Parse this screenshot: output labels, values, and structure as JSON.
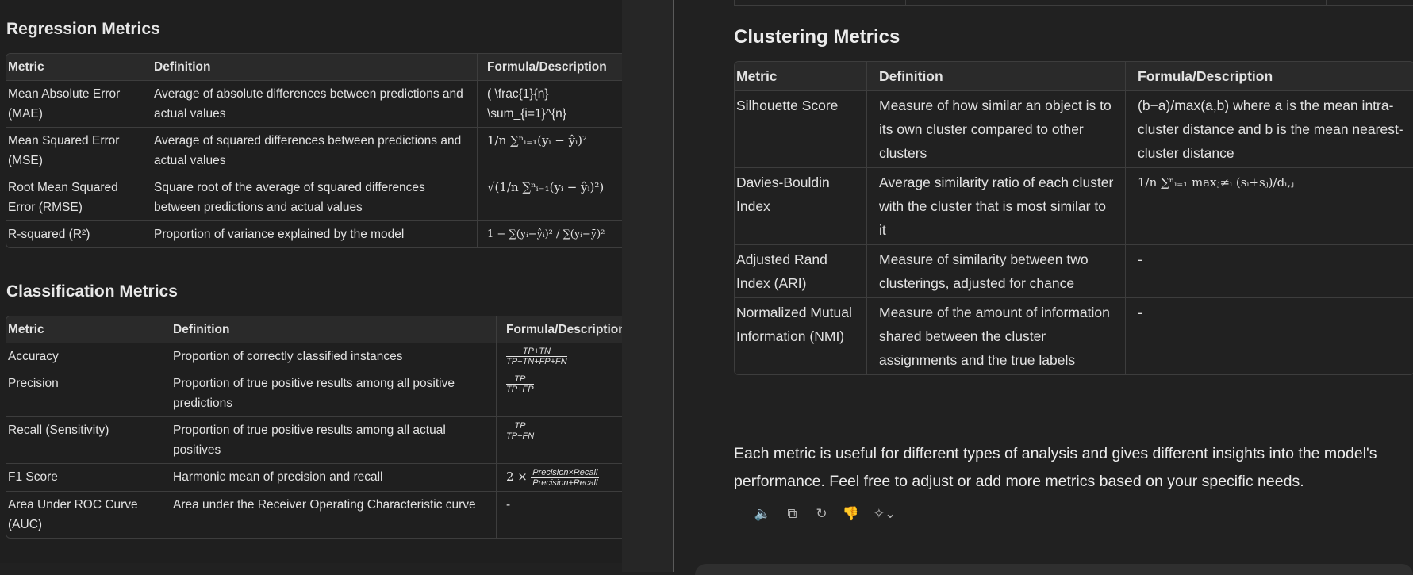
{
  "left": {
    "regression": {
      "heading": "Regression Metrics",
      "headers": [
        "Metric",
        "Definition",
        "Formula/Description"
      ],
      "rows": [
        {
          "metric": "Mean Absolute Error (MAE)",
          "definition": "Average of absolute differences between predictions and actual values",
          "formula": "( \\frac{1}{n} \\sum_{i=1}^{n}"
        },
        {
          "metric": "Mean Squared Error (MSE)",
          "definition": "Average of squared differences between predictions and actual values",
          "formula": "1/n ∑ⁿᵢ₌₁(yᵢ − ŷᵢ)²"
        },
        {
          "metric": "Root Mean Squared Error (RMSE)",
          "definition": "Square root of the average of squared differences between predictions and actual values",
          "formula": "√(1/n ∑ⁿᵢ₌₁(yᵢ − ŷᵢ)²)"
        },
        {
          "metric": "R-squared (R²)",
          "definition": "Proportion of variance explained by the model",
          "formula": "1 − ∑(yᵢ−ŷᵢ)² / ∑(yᵢ−ȳ)²"
        }
      ]
    },
    "classification": {
      "heading": "Classification Metrics",
      "headers": [
        "Metric",
        "Definition",
        "Formula/Description"
      ],
      "rows": [
        {
          "metric": "Accuracy",
          "definition": "Proportion of correctly classified instances",
          "num": "TP+TN",
          "den": "TP+TN+FP+FN"
        },
        {
          "metric": "Precision",
          "definition": "Proportion of true positive results among all positive predictions",
          "num": "TP",
          "den": "TP+FP"
        },
        {
          "metric": "Recall (Sensitivity)",
          "definition": "Proportion of true positive results among all actual positives",
          "num": "TP",
          "den": "TP+FN"
        },
        {
          "metric": "F1 Score",
          "definition": "Harmonic mean of precision and recall",
          "prefix": "2 ×",
          "num": "Precision×Recall",
          "den": "Precision+Recall"
        },
        {
          "metric": "Area Under ROC Curve (AUC)",
          "definition": "Area under the Receiver Operating Characteristic curve",
          "text": "-"
        }
      ]
    }
  },
  "right": {
    "heading": "Clustering Metrics",
    "headers": [
      "Metric",
      "Definition",
      "Formula/Description"
    ],
    "rows": [
      {
        "metric": "Silhouette Score",
        "definition": "Measure of how similar an object is to its own cluster compared to other clusters",
        "formula": "(b−a)/max(a,b) where a is the mean intra-cluster distance and b is the mean nearest-cluster distance"
      },
      {
        "metric": "Davies-Bouldin Index",
        "definition": "Average similarity ratio of each cluster with the cluster that is most similar to it",
        "formula": "1/n ∑ⁿᵢ₌₁ maxⱼ≠ᵢ (sᵢ+sⱼ)/dᵢ,ⱼ"
      },
      {
        "metric": "Adjusted Rand Index (ARI)",
        "definition": "Measure of similarity between two clusterings, adjusted for chance",
        "formula": "-"
      },
      {
        "metric": "Normalized Mutual Information (NMI)",
        "definition": "Measure of the amount of information shared between the cluster assignments and the true labels",
        "formula": "-"
      }
    ],
    "closing": "Each metric is useful for different types of analysis and gives different insights into the model's performance. Feel free to adjust or add more metrics based on your specific needs.",
    "actions": [
      {
        "name": "read-aloud-icon",
        "glyph": "🔈"
      },
      {
        "name": "copy-icon",
        "glyph": "⧉"
      },
      {
        "name": "regenerate-icon",
        "glyph": "↻"
      },
      {
        "name": "thumbs-down-icon",
        "glyph": "👎"
      },
      {
        "name": "sparkle-model-icon",
        "glyph": "✧⌄"
      }
    ]
  }
}
